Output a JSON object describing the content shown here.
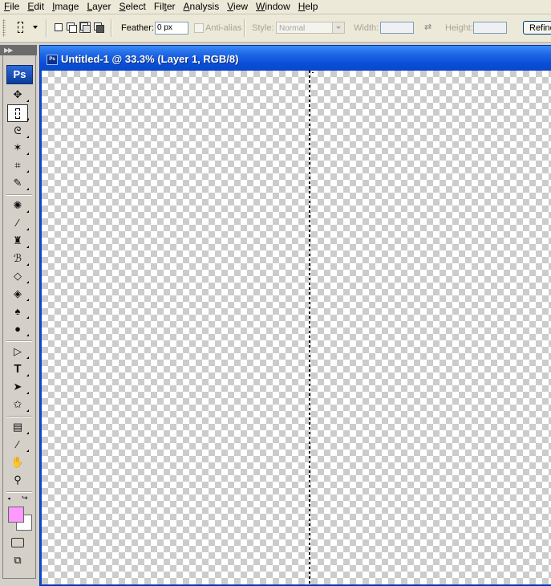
{
  "menu": [
    {
      "key": "F",
      "rest": "ile"
    },
    {
      "key": "E",
      "rest": "dit"
    },
    {
      "key": "I",
      "rest": "mage"
    },
    {
      "key": "L",
      "rest": "ayer",
      "pre": ""
    },
    {
      "key": "S",
      "rest": "elect"
    },
    {
      "key": "T",
      "rest": "r",
      "pre": "Fil"
    },
    {
      "key": "A",
      "rest": "nalysis"
    },
    {
      "key": "V",
      "rest": "iew"
    },
    {
      "key": "W",
      "rest": "indow"
    },
    {
      "key": "H",
      "rest": "elp"
    }
  ],
  "menu_labels": {
    "file_u": "F",
    "file_r": "ile",
    "edit_u": "E",
    "edit_r": "dit",
    "image_u": "I",
    "image_r": "mage",
    "layer_u": "L",
    "layer_r": "ayer",
    "select_u": "S",
    "select_r": "elect",
    "filter_p": "Fil",
    "filter_u": "t",
    "filter_r": "er",
    "analysis_u": "A",
    "analysis_r": "nalysis",
    "view_u": "V",
    "view_r": "iew",
    "window_u": "W",
    "window_r": "indow",
    "help_u": "H",
    "help_r": "elp"
  },
  "options": {
    "feather_label": "Feather:",
    "feather_value": "0 px",
    "antialias_label": "Anti-alias",
    "style_label": "Style:",
    "style_value": "Normal",
    "width_label": "Width:",
    "height_label": "Height:",
    "refine_label": "Refine"
  },
  "tools": {
    "ps_logo": "Ps"
  },
  "document": {
    "title": "Untitled-1 @ 33.3% (Layer 1, RGB/8)",
    "icon_text": "Ps"
  },
  "colors": {
    "foreground": "#ff99ff",
    "background": "#ffffff",
    "titlebar": "#1f66e5"
  }
}
